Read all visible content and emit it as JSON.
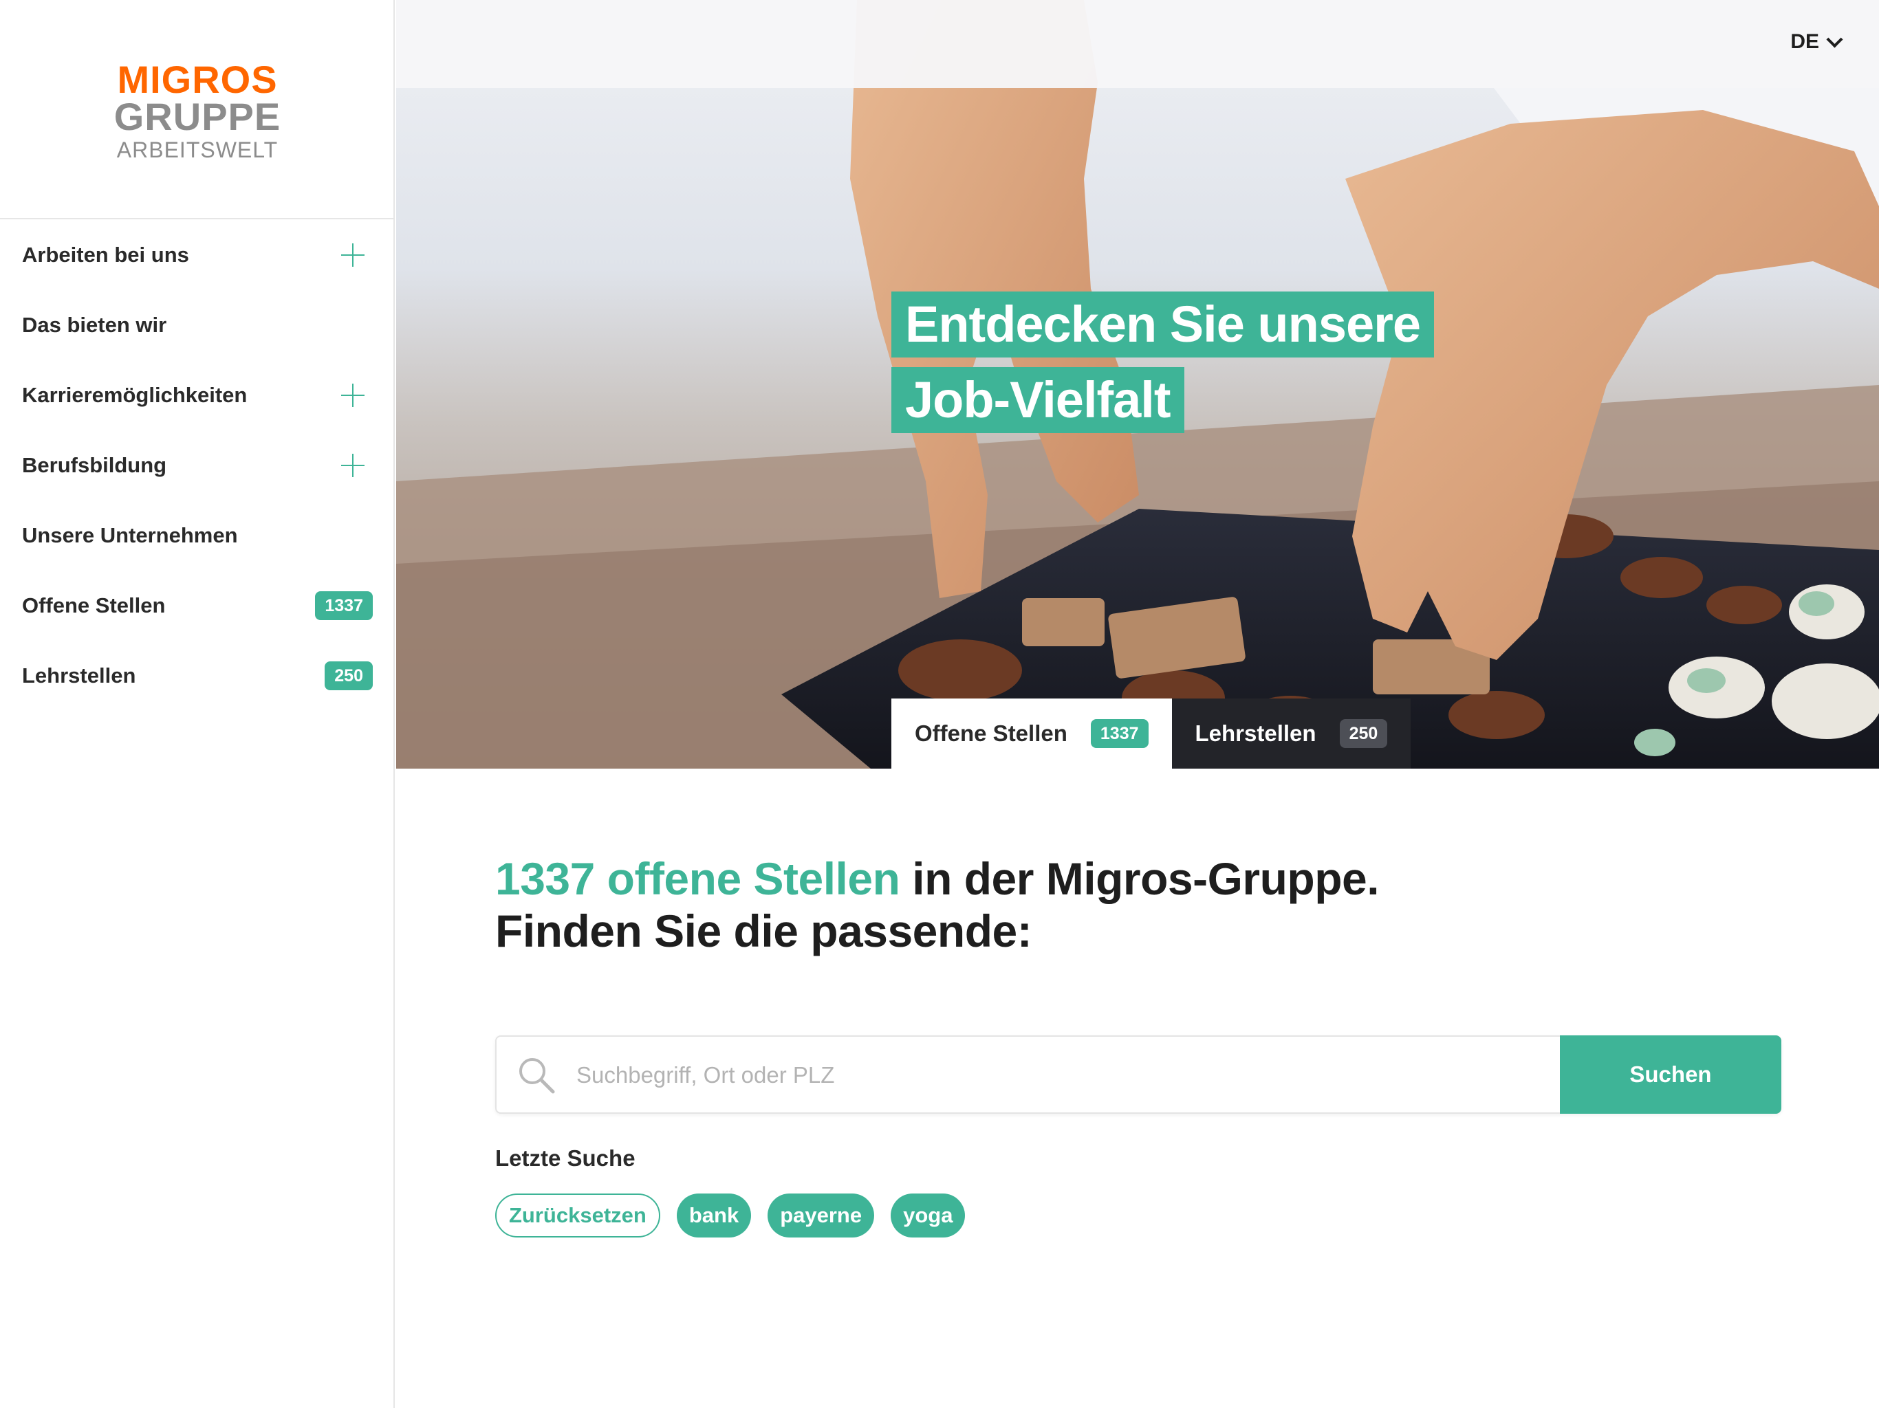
{
  "brand": {
    "logo_line1": "MIGROS",
    "logo_line2": "GRUPPE",
    "logo_line3": "ARBEITSWELT",
    "primary_color": "#3eb497",
    "logo_orange": "#ff6600",
    "logo_gray": "#8c8c8c"
  },
  "header": {
    "language": "DE",
    "language_icon": "chevron-down-icon"
  },
  "sidebar": {
    "items": [
      {
        "label": "Arbeiten bei uns",
        "icon": "plus-icon"
      },
      {
        "label": "Das bieten wir"
      },
      {
        "label": "Karrieremöglichkeiten",
        "icon": "plus-icon"
      },
      {
        "label": "Berufsbildung",
        "icon": "plus-icon"
      },
      {
        "label": "Unsere Unternehmen"
      },
      {
        "label": "Offene Stellen",
        "badge": "1337"
      },
      {
        "label": "Lehrstellen",
        "badge": "250"
      }
    ]
  },
  "hero": {
    "headline_line1": "Entdecken Sie unsere",
    "headline_line2": "Job-Vielfalt",
    "tabs": [
      {
        "label": "Offene Stellen",
        "count": "1337",
        "active": true
      },
      {
        "label": "Lehrstellen",
        "count": "250",
        "active": false
      }
    ]
  },
  "main": {
    "title_highlight": "1337 offene Stellen",
    "title_rest": " in der Migros-Gruppe.",
    "title_line2": "Finden Sie die passende:",
    "search": {
      "placeholder": "Suchbegriff, Ort oder PLZ",
      "value": "",
      "button_label": "Suchen",
      "icon": "search-icon"
    },
    "recent": {
      "label": "Letzte Suche",
      "reset_label": "Zurücksetzen",
      "terms": [
        "bank",
        "payerne",
        "yoga"
      ]
    }
  }
}
